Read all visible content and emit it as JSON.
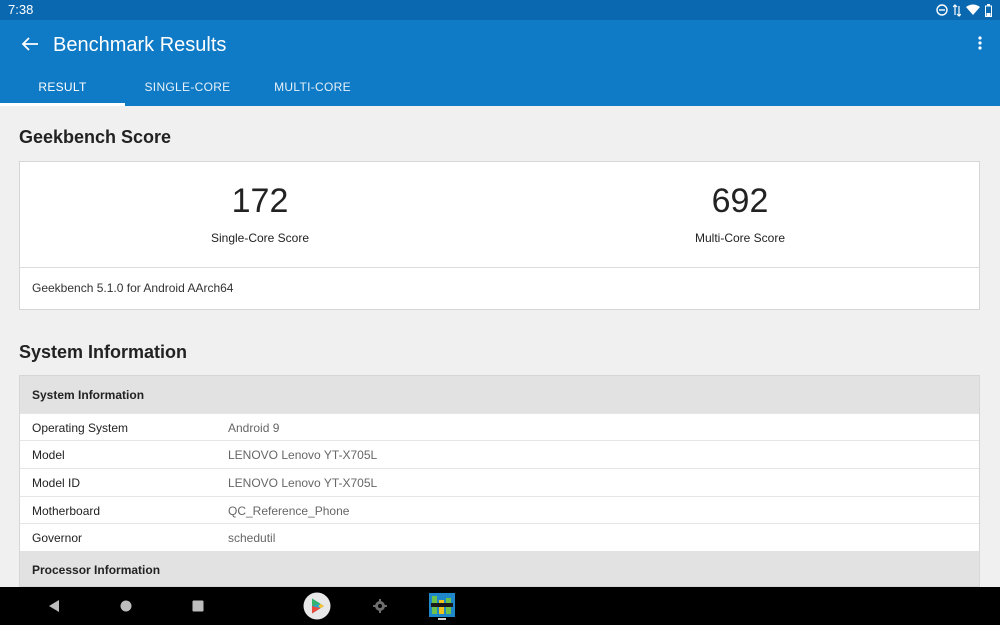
{
  "status_bar": {
    "time": "7:38"
  },
  "app_bar": {
    "title": "Benchmark Results"
  },
  "tabs": [
    {
      "label": "RESULT",
      "active": true
    },
    {
      "label": "SINGLE-CORE",
      "active": false
    },
    {
      "label": "MULTI-CORE",
      "active": false
    }
  ],
  "geekbench": {
    "section_title": "Geekbench Score",
    "single_core": {
      "value": "172",
      "label": "Single-Core Score"
    },
    "multi_core": {
      "value": "692",
      "label": "Multi-Core Score"
    },
    "version": "Geekbench 5.1.0 for Android AArch64"
  },
  "system": {
    "section_title": "System Information",
    "group_header": "System Information",
    "rows": [
      {
        "key": "Operating System",
        "value": "Android 9"
      },
      {
        "key": "Model",
        "value": "LENOVO Lenovo YT-X705L"
      },
      {
        "key": "Model ID",
        "value": "LENOVO Lenovo YT-X705L"
      },
      {
        "key": "Motherboard",
        "value": "QC_Reference_Phone"
      },
      {
        "key": "Governor",
        "value": "schedutil"
      }
    ],
    "next_group_header": "Processor Information"
  },
  "colors": {
    "status_bar": "#0a68b0",
    "app_bar": "#0f7ac5",
    "background": "#f0f0f0",
    "table_header": "#e2e2e2"
  },
  "icons": {
    "status": [
      "dnd-icon",
      "data-arrows-icon",
      "wifi-icon",
      "battery-icon"
    ],
    "app_bar": [
      "back-arrow-icon",
      "overflow-menu-icon"
    ],
    "nav_bar": [
      "nav-back-icon",
      "nav-home-icon",
      "nav-recents-icon",
      "play-store-icon",
      "settings-gear-icon",
      "geekbench-app-icon"
    ]
  }
}
